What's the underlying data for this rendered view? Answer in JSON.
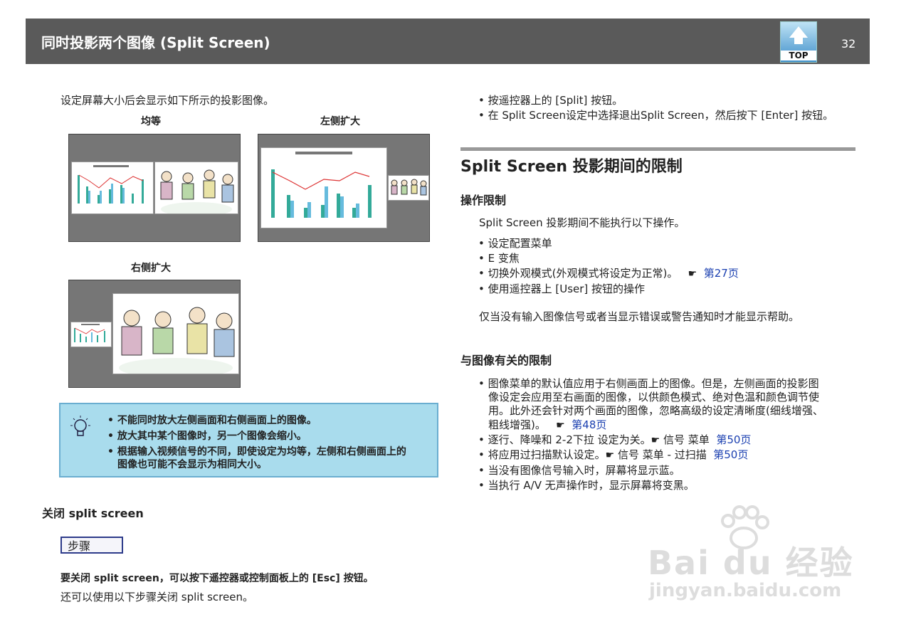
{
  "header": {
    "title": "同时投影两个图像 (Split Screen)",
    "top_label": "TOP",
    "page_number": "32"
  },
  "left": {
    "intro": "设定屏幕大小后会显示如下所示的投影图像。",
    "captions": {
      "equal": "均等",
      "left_zoom": "左侧扩大",
      "right_zoom": "右侧扩大"
    },
    "notes": [
      "不能同时放大左侧画面和右侧画面上的图像。",
      "放大其中某个图像时，另一个图像会缩小。",
      "根据输入视频信号的不同，即使设定为均等，左侧和右侧画面上的",
      "图像也可能不会显示为相同大小。"
    ],
    "close_heading": "关闭  split  screen",
    "step_label": "步骤",
    "step_bold": "要关闭  split  screen，可以按下遥控器或控制面板上的  [Esc]  按钮。",
    "step_note": "还可以使用以下步骤关闭  split  screen。"
  },
  "right": {
    "top_bullets": [
      "按遥控器上的  [Split]  按钮。",
      "在   Split  Screen设定中选择退出Split  Screen，然后按下  [Enter]  按钮。"
    ],
    "section_title": "Split  Screen  投影期间的限制",
    "op_heading": "操作限制",
    "op_intro": "Split  Screen  投影期间不能执行以下操作。",
    "op_bullets": [
      "设定配置菜单",
      "E  变焦",
      "切换外观模式(外观模式将设定为正常)。",
      "使用遥控器上  [User]  按钮的操作"
    ],
    "op_link": "第27页",
    "op_note": "仅当没有输入图像信号或者当显示错误或警告通知时才能显示帮助。",
    "img_heading": "与图像有关的限制",
    "img_lines": [
      "图像菜单的默认值应用于右侧画面上的图像。但是，左侧画面的投影图",
      "像设定会应用至右画面的图像，以供颜色模式、绝对色温和颜色调节使",
      "用。此外还会针对两个画面的图像，忽略高级的设定清晰度(细线增强、",
      "粗线增强)。"
    ],
    "link48": "第48页",
    "b2": "逐行、降噪和  2-2下拉  设定为关。",
    "b2_menu": "信号  菜单",
    "link50a": "第50页",
    "b3": "将应用过扫描默认设定。",
    "b3_menu": "信号  菜单  -  过扫描",
    "link50b": "第50页",
    "b4": "当没有图像信号输入时，屏幕将显示蓝。",
    "b5": "当执行  A/V  无声操作时，显示屏幕将变黑。",
    "hand": "☛"
  },
  "watermark": {
    "main": "Bai du 经验",
    "sub": "jingyan.baidu.com"
  }
}
